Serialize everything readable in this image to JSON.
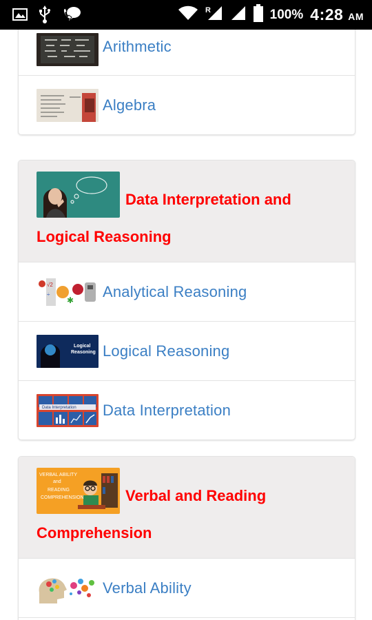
{
  "status_bar": {
    "battery_percent": "100%",
    "time": "4:28",
    "ampm": "AM",
    "left_icons": [
      "image-icon",
      "usb-icon",
      "call-bubble-icon"
    ],
    "right_icons": [
      "wifi-icon",
      "signal-roaming-icon",
      "signal-icon",
      "battery-icon"
    ]
  },
  "cards": [
    {
      "items": [
        {
          "label": "Arithmetic",
          "thumb": "chalkboard-arithmetic-image"
        },
        {
          "label": "Algebra",
          "thumb": "algebra-notes-image"
        }
      ]
    },
    {
      "header": {
        "title_line1": "Data Interpretation and",
        "title_line2": "Logical Reasoning",
        "thumb": "thinking-girl-chalkboard-image"
      },
      "items": [
        {
          "label": "Analytical Reasoning",
          "thumb": "analytical-icons-image"
        },
        {
          "label": "Logical Reasoning",
          "thumb": "logical-reasoning-head-image"
        },
        {
          "label": "Data Interpretation",
          "thumb": "data-interpretation-charts-image"
        }
      ]
    },
    {
      "header": {
        "title_line1": "Verbal and Reading",
        "title_line2": "Comprehension",
        "thumb": "verbal-ability-reading-image",
        "thumb_text": [
          "VERBAL ABILITY",
          "and",
          "READING",
          "COMPREHENSION"
        ]
      },
      "items": [
        {
          "label": "Verbal Ability",
          "thumb": "verbal-head-bubbles-image"
        }
      ]
    }
  ],
  "colors": {
    "header_title": "#ff0000",
    "item_label": "#3b7fc4",
    "header_bg": "#efeded",
    "status_bar_bg": "#000000"
  }
}
